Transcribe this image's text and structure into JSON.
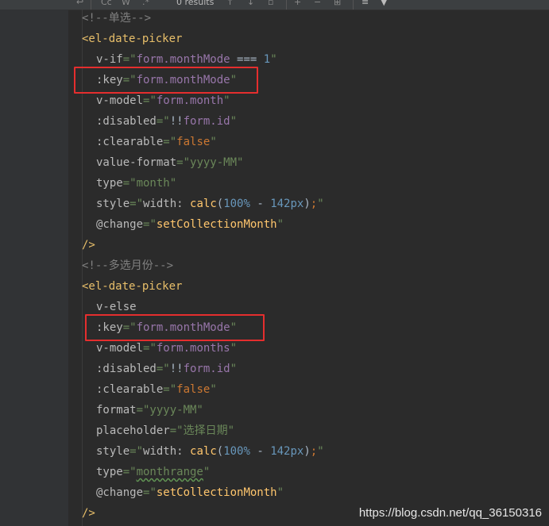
{
  "find_bar": {
    "results_text": "0 results",
    "match_case_label": "Cc",
    "whole_words_label": "W",
    "regex_label": ".*"
  },
  "code_lines": [
    {
      "indent": 0,
      "tokens": [
        {
          "t": "comment",
          "v": "<!--单选-->"
        }
      ]
    },
    {
      "indent": 0,
      "tokens": [
        {
          "t": "tag",
          "v": "<el-date-picker"
        }
      ]
    },
    {
      "indent": 1,
      "tokens": [
        {
          "t": "attr",
          "v": "v-if"
        },
        {
          "t": "str",
          "v": "=\""
        },
        {
          "t": "id",
          "v": "form.monthMode"
        },
        {
          "t": "eq",
          "v": " === "
        },
        {
          "t": "num",
          "v": "1"
        },
        {
          "t": "str",
          "v": "\""
        }
      ]
    },
    {
      "indent": 1,
      "tokens": [
        {
          "t": "attr",
          "v": ":key"
        },
        {
          "t": "str",
          "v": "=\""
        },
        {
          "t": "id",
          "v": "form.monthMode"
        },
        {
          "t": "str",
          "v": "\""
        }
      ]
    },
    {
      "indent": 1,
      "tokens": [
        {
          "t": "attr",
          "v": "v-model"
        },
        {
          "t": "str",
          "v": "=\""
        },
        {
          "t": "id",
          "v": "form.month"
        },
        {
          "t": "str",
          "v": "\""
        }
      ]
    },
    {
      "indent": 1,
      "tokens": [
        {
          "t": "attr",
          "v": ":disabled"
        },
        {
          "t": "str",
          "v": "=\""
        },
        {
          "t": "eq",
          "v": "!!"
        },
        {
          "t": "id",
          "v": "form.id"
        },
        {
          "t": "str",
          "v": "\""
        }
      ]
    },
    {
      "indent": 1,
      "tokens": [
        {
          "t": "attr",
          "v": ":clearable"
        },
        {
          "t": "str",
          "v": "=\""
        },
        {
          "t": "kw",
          "v": "false"
        },
        {
          "t": "str",
          "v": "\""
        }
      ]
    },
    {
      "indent": 1,
      "tokens": [
        {
          "t": "attr",
          "v": "value-format"
        },
        {
          "t": "str",
          "v": "=\"yyyy-MM\""
        }
      ]
    },
    {
      "indent": 1,
      "tokens": [
        {
          "t": "attr",
          "v": "type"
        },
        {
          "t": "str",
          "v": "=\"month\""
        }
      ]
    },
    {
      "indent": 1,
      "tokens": [
        {
          "t": "attr",
          "v": "style"
        },
        {
          "t": "str",
          "v": "=\""
        },
        {
          "t": "attr",
          "v": "width: "
        },
        {
          "t": "fn",
          "v": "calc"
        },
        {
          "t": "eq",
          "v": "("
        },
        {
          "t": "num",
          "v": "100%"
        },
        {
          "t": "eq",
          "v": " - "
        },
        {
          "t": "num",
          "v": "142px"
        },
        {
          "t": "eq",
          "v": ")"
        },
        {
          "t": "kw",
          "v": ";"
        },
        {
          "t": "str",
          "v": "\""
        }
      ]
    },
    {
      "indent": 1,
      "tokens": [
        {
          "t": "attr",
          "v": "@change"
        },
        {
          "t": "str",
          "v": "=\""
        },
        {
          "t": "fn",
          "v": "setCollectionMonth"
        },
        {
          "t": "str",
          "v": "\""
        }
      ]
    },
    {
      "indent": 0,
      "tokens": [
        {
          "t": "tag",
          "v": "/>"
        }
      ]
    },
    {
      "indent": 0,
      "tokens": [
        {
          "t": "comment",
          "v": "<!--多选月份-->"
        }
      ]
    },
    {
      "indent": 0,
      "tokens": [
        {
          "t": "tag",
          "v": "<el-date-picker"
        }
      ]
    },
    {
      "indent": 1,
      "tokens": [
        {
          "t": "attr",
          "v": "v-else"
        }
      ]
    },
    {
      "indent": 1,
      "tokens": [
        {
          "t": "attr",
          "v": ":key"
        },
        {
          "t": "str",
          "v": "=\""
        },
        {
          "t": "id",
          "v": "form.monthMode"
        },
        {
          "t": "str",
          "v": "\""
        }
      ]
    },
    {
      "indent": 1,
      "tokens": [
        {
          "t": "attr",
          "v": "v-model"
        },
        {
          "t": "str",
          "v": "=\""
        },
        {
          "t": "id",
          "v": "form.months"
        },
        {
          "t": "str",
          "v": "\""
        }
      ]
    },
    {
      "indent": 1,
      "tokens": [
        {
          "t": "attr",
          "v": ":disabled"
        },
        {
          "t": "str",
          "v": "=\""
        },
        {
          "t": "eq",
          "v": "!!"
        },
        {
          "t": "id",
          "v": "form.id"
        },
        {
          "t": "str",
          "v": "\""
        }
      ]
    },
    {
      "indent": 1,
      "tokens": [
        {
          "t": "attr",
          "v": ":clearable"
        },
        {
          "t": "str",
          "v": "=\""
        },
        {
          "t": "kw",
          "v": "false"
        },
        {
          "t": "str",
          "v": "\""
        }
      ]
    },
    {
      "indent": 1,
      "tokens": [
        {
          "t": "attr",
          "v": "format"
        },
        {
          "t": "str",
          "v": "=\"yyyy-MM\""
        }
      ]
    },
    {
      "indent": 1,
      "tokens": [
        {
          "t": "attr",
          "v": "placeholder"
        },
        {
          "t": "str",
          "v": "=\"选择日期\""
        }
      ]
    },
    {
      "indent": 1,
      "tokens": [
        {
          "t": "attr",
          "v": "style"
        },
        {
          "t": "str",
          "v": "=\""
        },
        {
          "t": "attr",
          "v": "width: "
        },
        {
          "t": "fn",
          "v": "calc"
        },
        {
          "t": "eq",
          "v": "("
        },
        {
          "t": "num",
          "v": "100%"
        },
        {
          "t": "eq",
          "v": " - "
        },
        {
          "t": "num",
          "v": "142px"
        },
        {
          "t": "eq",
          "v": ")"
        },
        {
          "t": "kw",
          "v": ";"
        },
        {
          "t": "str",
          "v": "\""
        }
      ]
    },
    {
      "indent": 1,
      "tokens": [
        {
          "t": "attr",
          "v": "type"
        },
        {
          "t": "str",
          "v": "=\""
        },
        {
          "t": "squig",
          "v": "monthrange"
        },
        {
          "t": "str",
          "v": "\""
        }
      ]
    },
    {
      "indent": 1,
      "tokens": [
        {
          "t": "attr",
          "v": "@change"
        },
        {
          "t": "str",
          "v": "=\""
        },
        {
          "t": "fn",
          "v": "setCollectionMonth"
        },
        {
          "t": "str",
          "v": "\""
        }
      ]
    },
    {
      "indent": 0,
      "tokens": [
        {
          "t": "tag",
          "v": "/>"
        }
      ]
    }
  ],
  "highlighted_lines": [
    3,
    15
  ],
  "annotation_color": "#e52e2e",
  "watermark": "https://blog.csdn.net/qq_36150316"
}
